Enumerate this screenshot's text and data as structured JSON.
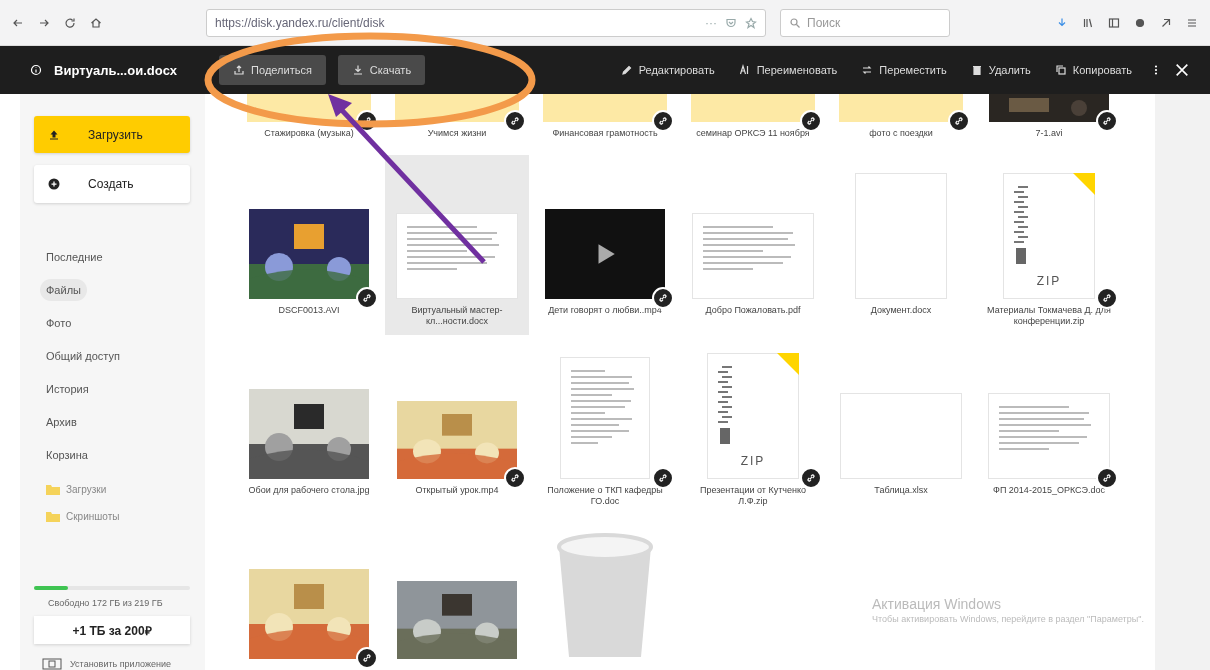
{
  "browser": {
    "url": "https://disk.yandex.ru/client/disk",
    "search_placeholder": "Поиск",
    "page_actions": "···"
  },
  "toolbar": {
    "file_name": "Виртуаль...ои.docx",
    "actions": [
      {
        "label": "Поделиться",
        "kind": "share"
      },
      {
        "label": "Скачать",
        "kind": "download"
      }
    ],
    "tools": [
      {
        "label": "Редактировать",
        "kind": "edit"
      },
      {
        "label": "Переименовать",
        "kind": "rename"
      },
      {
        "label": "Переместить",
        "kind": "move"
      },
      {
        "label": "Удалить",
        "kind": "delete"
      },
      {
        "label": "Копировать",
        "kind": "copy"
      }
    ]
  },
  "sidebar": {
    "upload": "Загрузить",
    "create": "Создать",
    "nav": [
      {
        "label": "Последние",
        "selected": false
      },
      {
        "label": "Файлы",
        "selected": true
      },
      {
        "label": "Фото",
        "selected": false
      },
      {
        "label": "Общий доступ",
        "selected": false
      },
      {
        "label": "История",
        "selected": false
      },
      {
        "label": "Архив",
        "selected": false
      },
      {
        "label": "Корзина",
        "selected": false
      }
    ],
    "folders": [
      "Загрузки",
      "Скриншоты"
    ],
    "storage": {
      "level": 0.22,
      "text": "Свободно 172 ГБ из 219 ГБ"
    },
    "offer": "+1 ТБ за 200₽",
    "install": "Установить приложение"
  },
  "file_rows": [
    {
      "cut": true,
      "items": [
        {
          "name": "Стажировка (музыка)",
          "kind": "folder",
          "shared": true,
          "selected": false
        },
        {
          "name": "Учимся жизни",
          "kind": "folder",
          "shared": true,
          "selected": false
        },
        {
          "name": "Финансовая грамотность",
          "kind": "folder",
          "shared": true,
          "selected": false
        },
        {
          "name": "семинар ОРКСЭ 11 ноября",
          "kind": "folder",
          "shared": true,
          "selected": false
        },
        {
          "name": "фото с поездки",
          "kind": "folder",
          "shared": true,
          "selected": false
        },
        {
          "name": "7-1.avi",
          "kind": "picture",
          "shared": true,
          "selected": false
        }
      ]
    },
    {
      "cut": false,
      "items": [
        {
          "name": "DSCF0013.AVI",
          "kind": "picture",
          "shared": true,
          "selected": false
        },
        {
          "name": "Виртуальный мастер-кл...ности.docx",
          "kind": "document",
          "shared": false,
          "selected": true
        },
        {
          "name": "Дети говорят о любви..mp4",
          "kind": "video",
          "shared": true,
          "selected": false
        },
        {
          "name": "Добро Пожаловать.pdf",
          "kind": "document",
          "shared": false,
          "selected": false
        },
        {
          "name": "Документ.docx",
          "kind": "blank",
          "shared": false,
          "selected": false
        },
        {
          "name": "Материалы Токмачева Д. для конференции.zip",
          "kind": "zip",
          "badge": "ZIP",
          "shared": true,
          "selected": false
        }
      ]
    },
    {
      "cut": false,
      "items": [
        {
          "name": "Обои для рабочего стола.jpg",
          "kind": "picture",
          "shared": false,
          "selected": false
        },
        {
          "name": "Открытый урок.mp4",
          "kind": "picture",
          "shared": true,
          "selected": false
        },
        {
          "name": "Положение о ТКП кафедры ГО.doc",
          "kind": "page",
          "shared": true,
          "selected": false
        },
        {
          "name": "Презентации от Кутченко Л.Ф.zip",
          "kind": "zip",
          "badge": "ZIP",
          "shared": true,
          "selected": false
        },
        {
          "name": "Таблица.xlsx",
          "kind": "sheet",
          "shared": false,
          "selected": false
        },
        {
          "name": "ФП 2014-2015_ОРКСЭ.doc",
          "kind": "document",
          "shared": true,
          "selected": false
        }
      ]
    },
    {
      "cut": false,
      "items": [
        {
          "kind": "picture",
          "shared": true,
          "selected": false
        },
        {
          "kind": "picture",
          "shared": false,
          "selected": false
        },
        {
          "kind": "trash",
          "shared": false,
          "selected": false
        }
      ]
    }
  ],
  "os_notice": {
    "title": "Активация Windows",
    "text": "Чтобы активировать Windows, перейдите в раздел \"Параметры\"."
  }
}
